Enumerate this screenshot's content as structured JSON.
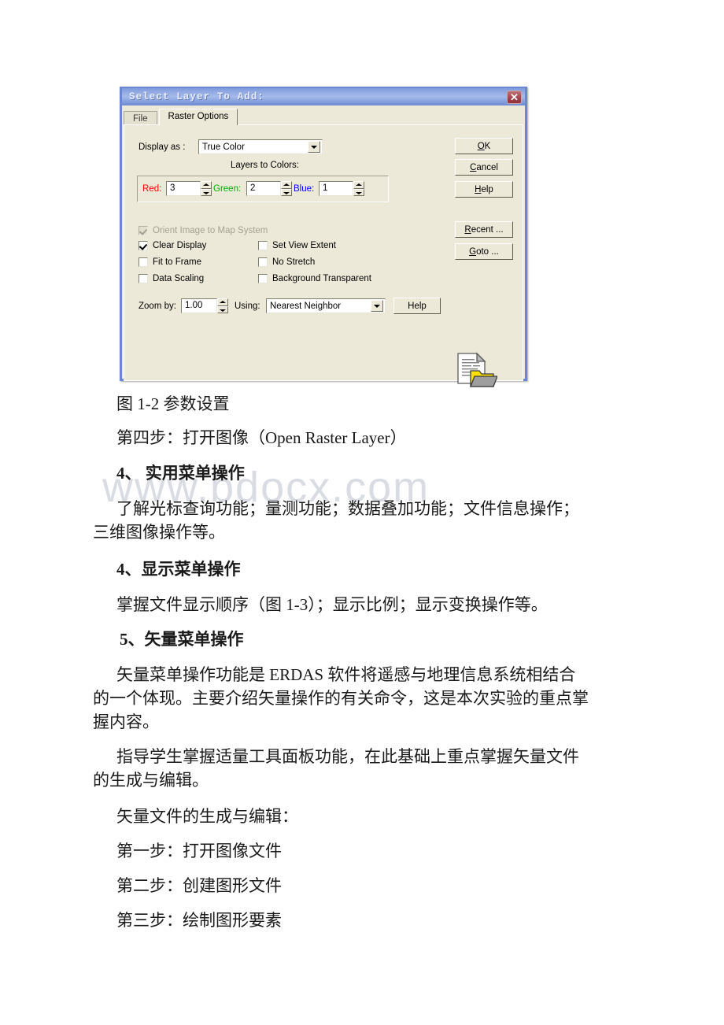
{
  "page": {
    "watermark": "www.bdocx.com",
    "background": "#ffffff"
  },
  "dialog": {
    "title": "Select Layer To Add:",
    "close_label": "✕",
    "tabs": [
      {
        "label": "File",
        "active": false
      },
      {
        "label": "Raster Options",
        "active": true
      }
    ],
    "display_as": {
      "label": "Display as :",
      "value": "True Color"
    },
    "layers_to_colors": {
      "group_label": "Layers to Colors:",
      "channels": [
        {
          "label": "Red:",
          "value": "3",
          "color": "#ff0000"
        },
        {
          "label": "Green:",
          "value": "2",
          "color": "#00b000"
        },
        {
          "label": "Blue:",
          "value": "1",
          "color": "#0000ff"
        }
      ]
    },
    "checkboxes": [
      {
        "label": "Orient Image to Map System",
        "checked": true,
        "disabled": true
      },
      {
        "label": "Clear Display",
        "checked": true,
        "disabled": false
      },
      {
        "label": "Fit to Frame",
        "checked": false,
        "disabled": false
      },
      {
        "label": "Data Scaling",
        "checked": false,
        "disabled": false
      },
      {
        "label": "Set View Extent",
        "checked": false,
        "disabled": false
      },
      {
        "label": "No Stretch",
        "checked": false,
        "disabled": false
      },
      {
        "label": "Background Transparent",
        "checked": false,
        "disabled": false
      }
    ],
    "zoom_row": {
      "zoom_label": "Zoom by:",
      "zoom_value": "1.00",
      "using_label": "Using:",
      "using_value": "Nearest Neighbor",
      "help_label": "Help"
    },
    "side_buttons": [
      {
        "accel": "O",
        "rest": "K"
      },
      {
        "accel": "C",
        "rest": "ancel"
      },
      {
        "accel": "H",
        "rest": "elp"
      },
      {
        "accel": "R",
        "rest": "ecent ..."
      },
      {
        "accel": "G",
        "rest": "oto ..."
      }
    ]
  },
  "document": {
    "lines": [
      {
        "text": "图 1-2 参数设置",
        "bold": false
      },
      {
        "text": "第四步：打开图像（Open Raster Layer）",
        "bold": false
      },
      {
        "text": "4、 实用菜单操作",
        "bold": true
      },
      {
        "text": "了解光标查询功能；量测功能；数据叠加功能；文件信息操作；",
        "bold": false
      },
      {
        "text": "三维图像操作等。",
        "bold": false
      },
      {
        "text": "4、显示菜单操作",
        "bold": true
      },
      {
        "text": "掌握文件显示顺序（图 1-3）；显示比例；显示变换操作等。",
        "bold": false
      },
      {
        "text": "5、矢量菜单操作",
        "bold": true
      },
      {
        "text": "矢量菜单操作功能是 ERDAS 软件将遥感与地理信息系统相结合",
        "bold": false
      },
      {
        "text": "的一个体现。主要介绍矢量操作的有关命令，这是本次实验的重点掌",
        "bold": false
      },
      {
        "text": "握内容。",
        "bold": false
      },
      {
        "text": "指导学生掌握适量工具面板功能，在此基础上重点掌握矢量文件",
        "bold": false
      },
      {
        "text": "的生成与编辑。",
        "bold": false
      },
      {
        "text": "矢量文件的生成与编辑：",
        "bold": false
      },
      {
        "text": "第一步：打开图像文件",
        "bold": false
      },
      {
        "text": "第二步：创建图形文件",
        "bold": false
      },
      {
        "text": "第三步：绘制图形要素",
        "bold": false
      }
    ]
  }
}
